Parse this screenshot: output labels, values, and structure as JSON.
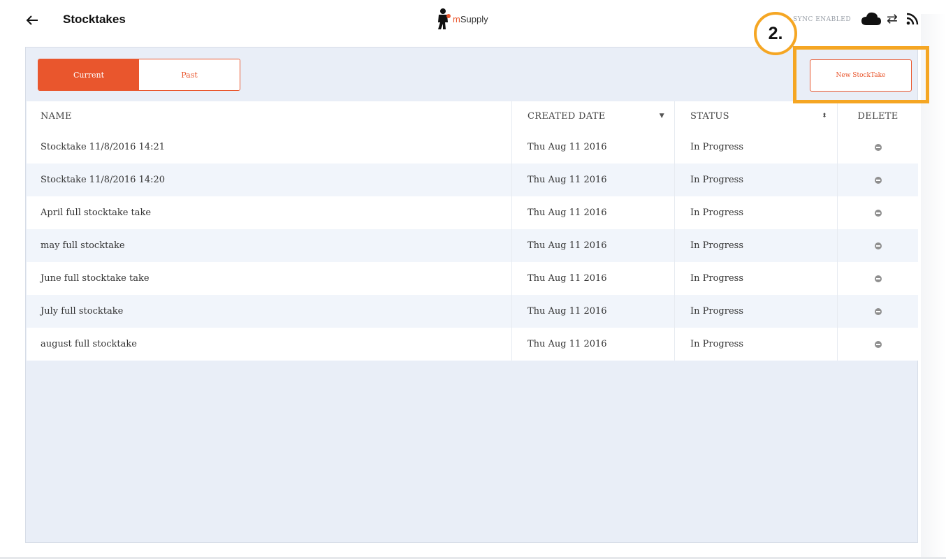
{
  "header": {
    "title": "Stocktakes",
    "logo_prefix": "m",
    "logo_text": "Supply",
    "sync_status": "SYNC ENABLED",
    "icons": [
      "back-arrow-icon",
      "cloud-icon",
      "swap-arrows-icon",
      "rss-icon"
    ]
  },
  "toggle": {
    "current_label": "Current",
    "past_label": "Past",
    "selected": "Current"
  },
  "toolbar": {
    "new_label": "New StockTake"
  },
  "table": {
    "columns": [
      "NAME",
      "CREATED DATE",
      "STATUS",
      "DELETE"
    ],
    "rows": [
      {
        "name": "Stocktake 11/8/2016 14:21",
        "date": "Thu Aug 11 2016",
        "status": "In Progress"
      },
      {
        "name": "Stocktake 11/8/2016 14:20",
        "date": "Thu Aug 11 2016",
        "status": "In Progress"
      },
      {
        "name": "April full stocktake take",
        "date": "Thu Aug 11 2016",
        "status": "In Progress"
      },
      {
        "name": "may full stocktake",
        "date": "Thu Aug 11 2016",
        "status": "In Progress"
      },
      {
        "name": "June full stocktake take",
        "date": "Thu Aug 11 2016",
        "status": "In Progress"
      },
      {
        "name": "July full stocktake",
        "date": "Thu Aug 11 2016",
        "status": "In Progress"
      },
      {
        "name": "august full stocktake",
        "date": "Thu Aug 11 2016",
        "status": "In Progress"
      }
    ]
  },
  "annotation": {
    "step_label": "2."
  },
  "colors": {
    "accent": "#e9562d",
    "highlight": "#f5a623",
    "panel": "#e9eef7"
  }
}
